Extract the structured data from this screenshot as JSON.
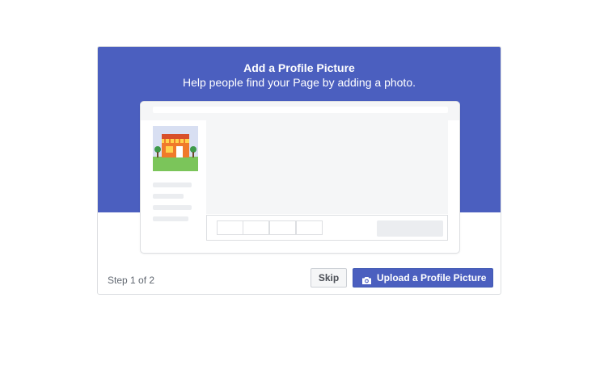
{
  "dialog": {
    "title": "Add a Profile Picture",
    "subtitle": "Help people find your Page by adding a photo."
  },
  "footer": {
    "step_text": "Step 1 of 2",
    "skip_label": "Skip",
    "upload_label": "Upload a Profile Picture"
  },
  "icons": {
    "upload": "camera-icon",
    "avatar_placeholder": "storefront-illustration"
  },
  "colors": {
    "banner": "#4b5fbf",
    "primary_button": "#4b5fbf"
  }
}
